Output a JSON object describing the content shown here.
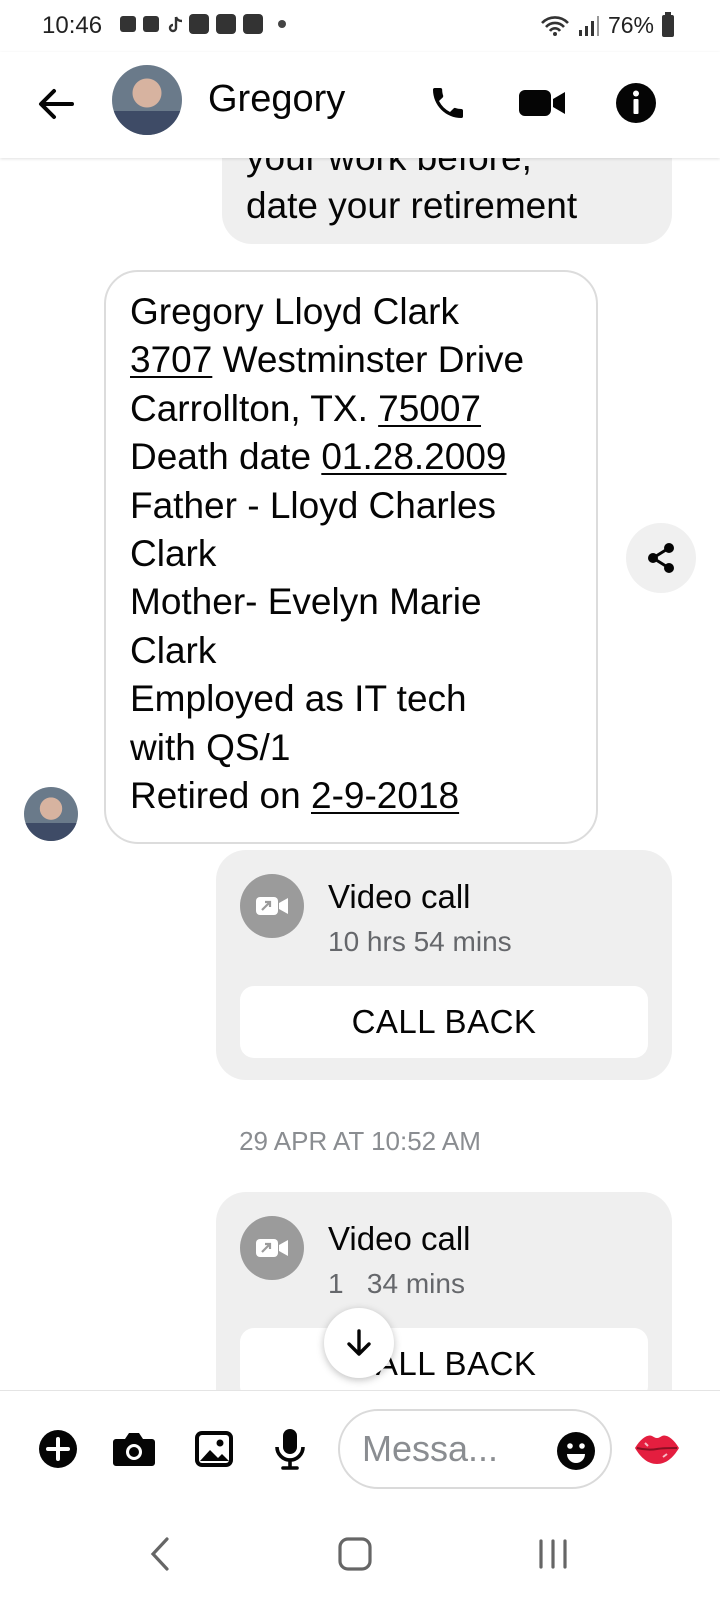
{
  "status_bar": {
    "time": "10:46",
    "battery": "76%"
  },
  "header": {
    "contact_name": "Gregory"
  },
  "messages": {
    "outgoing_partial": "your work before,\ndate your retirement",
    "incoming_lines": [
      {
        "plain": "Gregory Lloyd Clark",
        "link": "",
        "rest": ""
      },
      {
        "plain": "",
        "link": "3707",
        "rest": " Westminster Drive"
      },
      {
        "plain": "Carrollton, TX. ",
        "link": "75007",
        "rest": ""
      },
      {
        "plain": "Death date ",
        "link": "01.28.2009",
        "rest": ""
      },
      {
        "plain": "Father - Lloyd Charles",
        "link": "",
        "rest": ""
      },
      {
        "plain": "Clark",
        "link": "",
        "rest": ""
      },
      {
        "plain": "Mother- Evelyn Marie",
        "link": "",
        "rest": ""
      },
      {
        "plain": "Clark",
        "link": "",
        "rest": ""
      },
      {
        "plain": "Employed as IT tech",
        "link": "",
        "rest": ""
      },
      {
        "plain": "with QS/1",
        "link": "",
        "rest": ""
      },
      {
        "plain": "Retired on ",
        "link": "2-9-2018",
        "rest": ""
      }
    ]
  },
  "calls": [
    {
      "title": "Video call",
      "duration": "10 hrs 54 mins",
      "action": "CALL BACK"
    },
    {
      "title": "Video call",
      "duration": "1   34 mins",
      "action": "CALL BACK"
    }
  ],
  "timestamp": "29 APR AT 10:52 AM",
  "composer": {
    "placeholder": "Messa..."
  },
  "colors": {
    "accent_red": "#e41e3f",
    "bubble_gray": "#efefef",
    "secondary_text": "#65676b"
  }
}
